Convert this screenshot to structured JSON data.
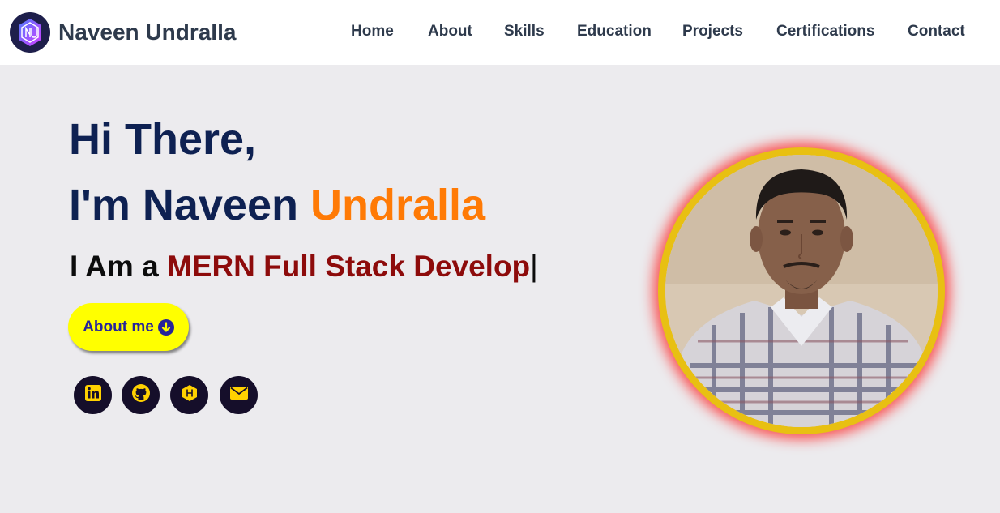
{
  "header": {
    "brand": "Naveen Undralla",
    "logo_icon": "nu-monogram-logo-icon",
    "nav": [
      {
        "label": "Home"
      },
      {
        "label": "About"
      },
      {
        "label": "Skills"
      },
      {
        "label": "Education"
      },
      {
        "label": "Projects"
      },
      {
        "label": "Certifications"
      },
      {
        "label": "Contact"
      }
    ]
  },
  "hero": {
    "greeting": "Hi There,",
    "intro_prefix": "I'm Naveen",
    "intro_accent": "Undralla",
    "typed_prefix": "I Am a",
    "typed_role": "MERN Full Stack Develop",
    "typed_cursor": "|",
    "about_button": "About me",
    "about_button_icon": "arrow-down-circle-icon",
    "socials": [
      {
        "icon": "linkedin-icon"
      },
      {
        "icon": "github-icon"
      },
      {
        "icon": "hashnode-icon"
      },
      {
        "icon": "envelope-icon"
      }
    ],
    "profile_photo": "profile-photo"
  },
  "colors": {
    "heading": "#0e2152",
    "accent_orange": "#ff7a05",
    "role_red": "#8d0b0b",
    "button_yellow": "#ffff00",
    "button_text": "#27249a",
    "social_bg": "#150e2a",
    "social_icon": "#ffd100",
    "photo_ring": "#e8c012",
    "photo_glow": "#ff1e1e",
    "page_bg": "#ecebee"
  }
}
